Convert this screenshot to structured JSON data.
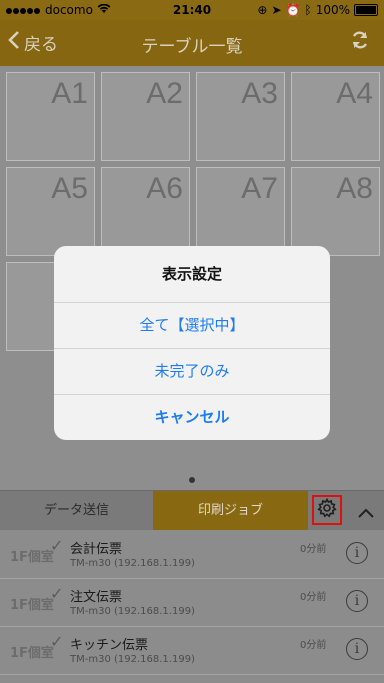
{
  "status_bar": {
    "carrier": "docomo",
    "time": "21:40",
    "battery": "100%"
  },
  "nav": {
    "back_label": "戻る",
    "title": "テーブル一覧"
  },
  "tables": [
    "A1",
    "A2",
    "A3",
    "A4",
    "A5",
    "A6",
    "A7",
    "A8",
    ""
  ],
  "tabs": {
    "send": "データ送信",
    "print": "印刷ジョブ"
  },
  "jobs": [
    {
      "room": "1F個室",
      "name": "会計伝票",
      "printer": "TM-m30 (192.168.1.199)",
      "ago": "0分前"
    },
    {
      "room": "1F個室",
      "name": "注文伝票",
      "printer": "TM-m30 (192.168.1.199)",
      "ago": "0分前"
    },
    {
      "room": "1F個室",
      "name": "キッチン伝票",
      "printer": "TM-m30 (192.168.1.199)",
      "ago": "0分前"
    }
  ],
  "dialog": {
    "title": "表示設定",
    "options": [
      "全て【選択中】",
      "未完了のみ"
    ],
    "cancel": "キャンセル"
  },
  "colors": {
    "accent": "#876611",
    "link": "#1e7cf2",
    "highlight": "#e01010"
  }
}
